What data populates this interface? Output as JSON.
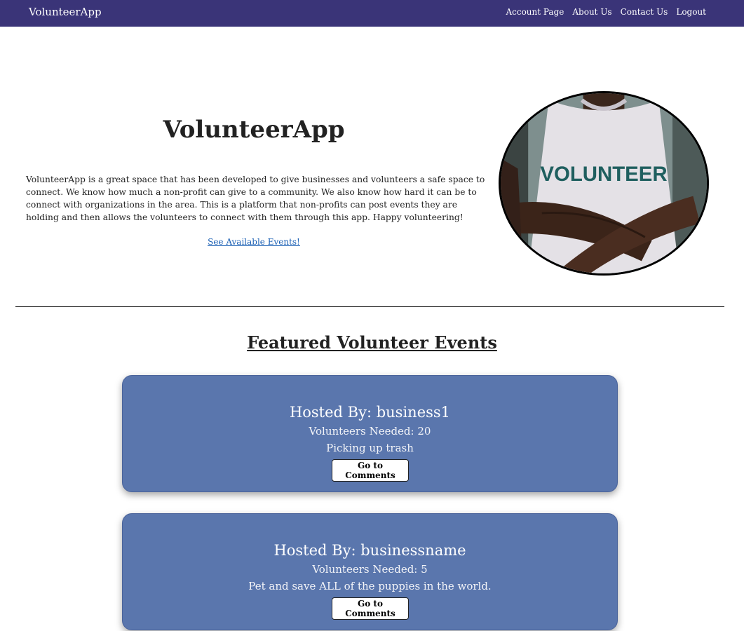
{
  "navbar": {
    "brand": "VolunteerApp",
    "links": [
      "Account Page",
      "About Us",
      "Contact Us",
      "Logout"
    ]
  },
  "hero": {
    "title": "VolunteerApp",
    "description": "VolunteerApp is a great space that has been developed to give businesses and volunteers a safe space to connect. We know how much a non-profit can give to a community. We also know how hard it can be to connect with organizations in the area. This is a platform that non-profits can post events they are holding and then allows the volunteers to connect with them through this app. Happy volunteering!",
    "link_label": "See Available Events!",
    "photo_text": "VOLUNTEER"
  },
  "featured": {
    "title": "Featured Volunteer Events",
    "events": [
      {
        "host": "Hosted By: business1",
        "needed": "Volunteers Needed: 20",
        "description": "Picking up trash",
        "button": "Go to Comments"
      },
      {
        "host": "Hosted By: businessname",
        "needed": "Volunteers Needed: 5",
        "description": "Pet and save ALL of the puppies in the world.",
        "button": "Go to Comments"
      }
    ]
  },
  "colors": {
    "navbar": "#3a3478",
    "card": "#5a76ad",
    "link": "#1a5fb4"
  }
}
